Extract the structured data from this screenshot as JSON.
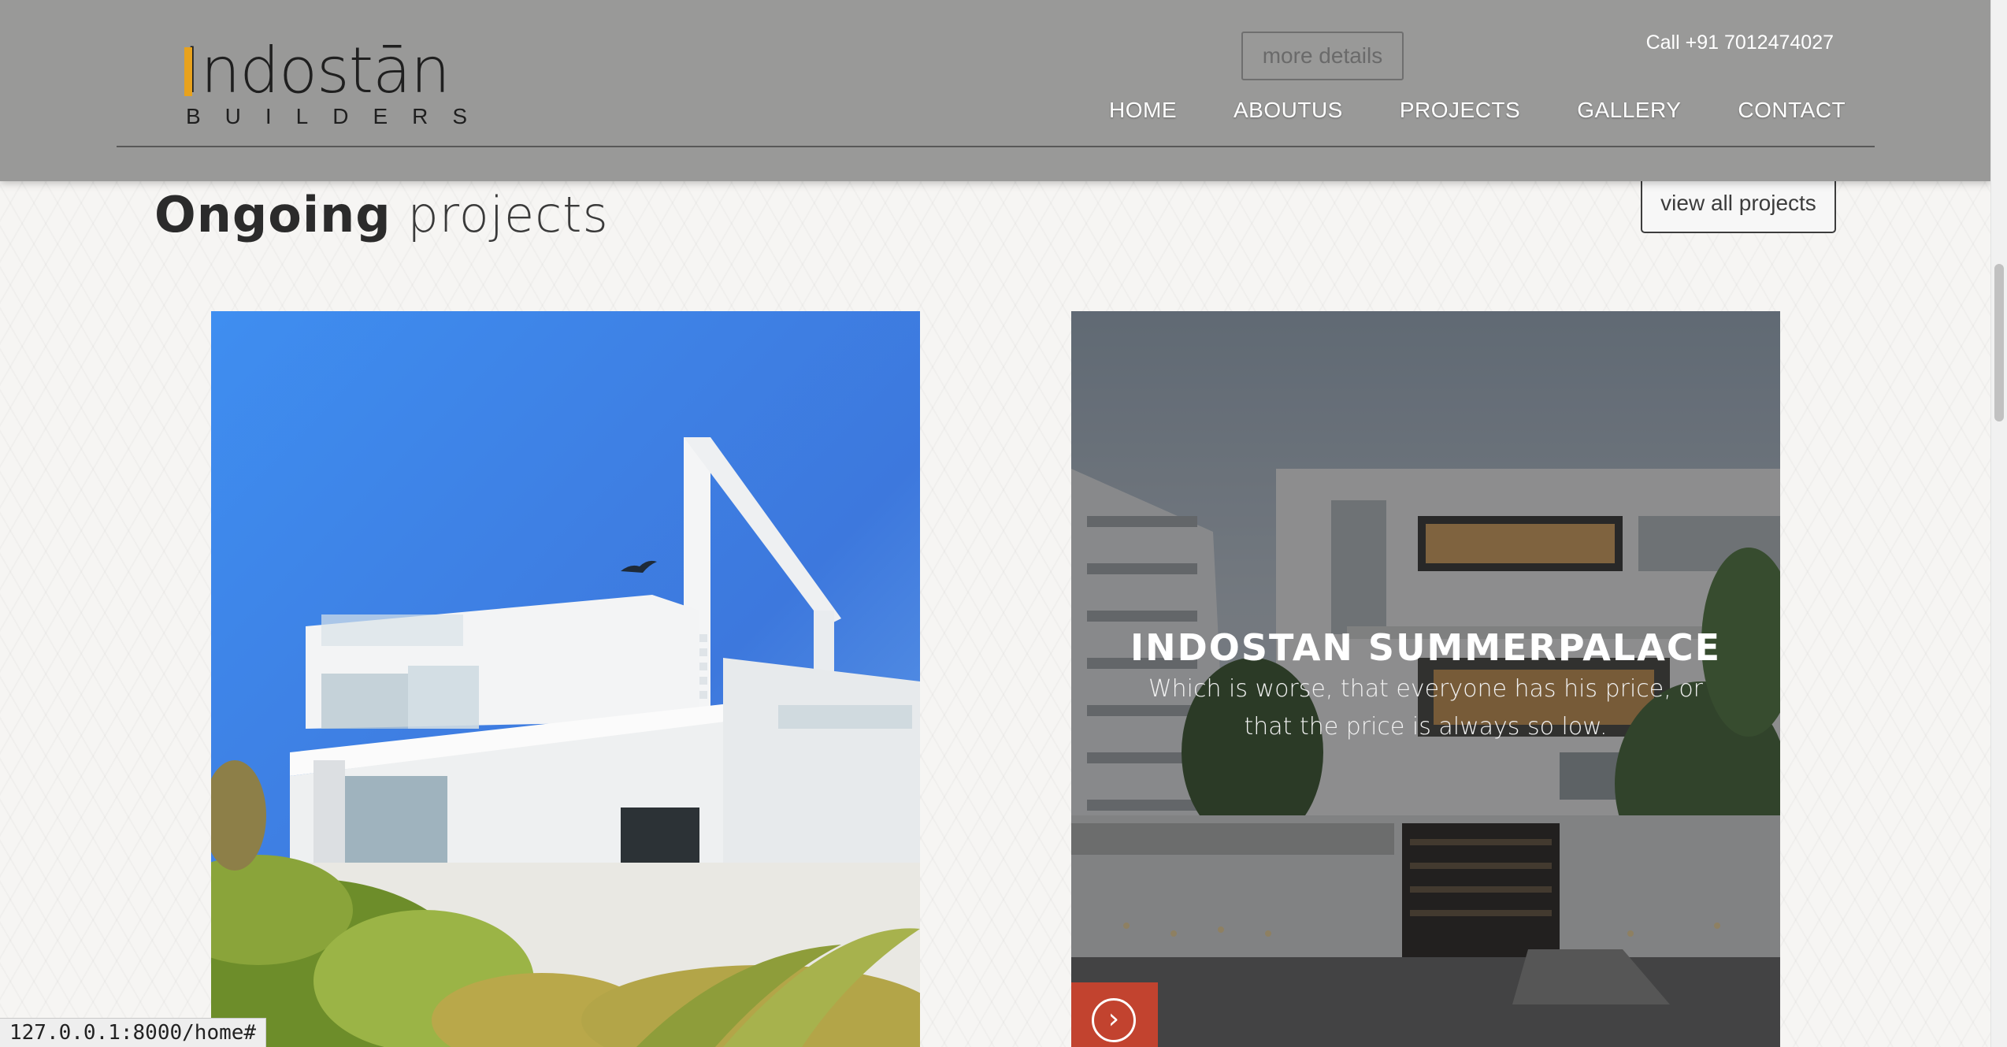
{
  "header": {
    "logo_text": "Indostān",
    "logo_subtext": "BUILDERS",
    "more_details_label": "more details",
    "phone": "Call +91 7012474027",
    "nav": [
      "HOME",
      "ABOUTUS",
      "PROJECTS",
      "GALLERY",
      "CONTACT"
    ]
  },
  "section": {
    "title_bold": "Ongoing",
    "title_light": "projects",
    "view_all_label": "view all projects"
  },
  "projects": [
    {
      "image": "white-villa-photo"
    },
    {
      "image": "summerpalace-photo",
      "title": "INDOSTAN SUMMERPALACE",
      "description": "Which is worse, that everyone has his price, or that the price is always so low.",
      "cta_icon": "chevron-right-circle-icon"
    }
  ],
  "status_bar": {
    "url": "127.0.0.1:8000/home#"
  },
  "colors": {
    "accent": "#c2432f",
    "logo_accent": "#e8a21d",
    "header_bg": "#999998"
  }
}
